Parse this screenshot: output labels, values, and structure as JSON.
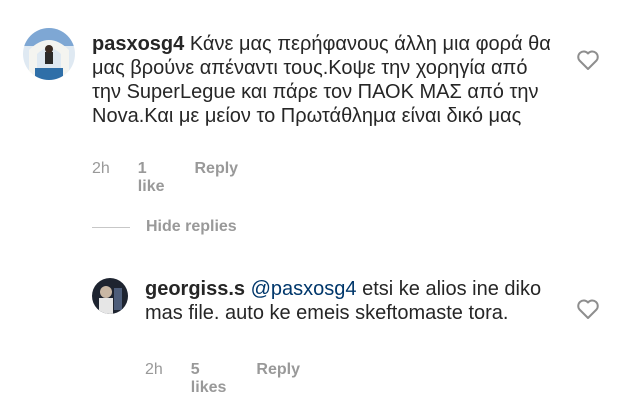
{
  "comment1": {
    "username": "pasxosg4",
    "body": "Κάνε μας περήφανους άλλη μια φορά θα μας βρούνε απέναντι τους.Κοψε την χορηγία από την SuperLegue και πάρε τον ΠΑΟΚ ΜΑΣ από την Nova.Και με μείον το Πρωτάθλημα είναι δικό μας",
    "time": "2h",
    "likes": "1 like",
    "reply_label": "Reply",
    "avatar_icon": "avatar-photo-icon"
  },
  "hide_replies": {
    "label": "Hide replies"
  },
  "comment2": {
    "username": "georgiss.s",
    "mention": "@pasxosg4",
    "body": "etsi ke alios ine diko mas file. auto ke emeis skeftomaste tora.",
    "time": "2h",
    "likes": "5 likes",
    "reply_label": "Reply",
    "avatar_icon": "avatar-photo-icon"
  },
  "colors": {
    "text": "#262626",
    "meta": "#999999",
    "mention": "#00376b",
    "divider": "#c7c7c7"
  }
}
